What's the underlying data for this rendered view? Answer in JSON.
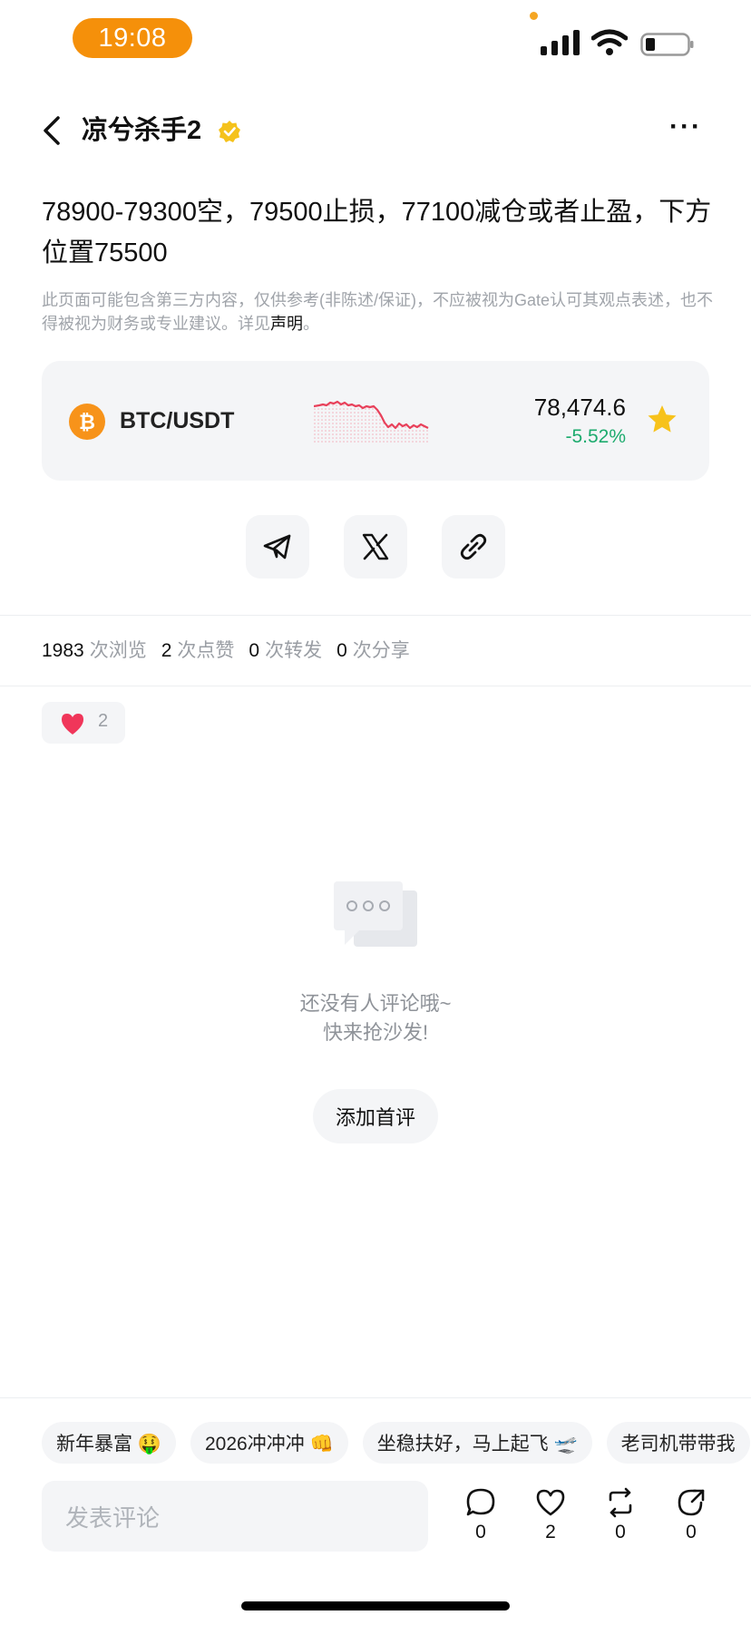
{
  "status_bar": {
    "time": "19:08",
    "signal_icon": "cellular-signal-icon",
    "wifi_icon": "wifi-icon",
    "battery_icon": "battery-low-icon"
  },
  "header": {
    "title": "凉兮杀手2",
    "verified_icon": "verified-badge-icon",
    "more": "···"
  },
  "post": {
    "text": "78900-79300空，79500止损，77100减仓或者止盈，下方位置75500",
    "disclaimer_prefix": "此页面可能包含第三方内容，仅供参考(非陈述/保证)，不应被视为Gate认可其观点表述，也不得被视为财务或专业建议。详见",
    "disclaimer_link": "声明",
    "disclaimer_suffix": "。"
  },
  "ticker": {
    "pair": "BTC/USDT",
    "price": "78,474.6",
    "change": "-5.52%",
    "sparkline_color": "#e8405a",
    "change_color": "#1dab6e",
    "favorited": true
  },
  "share": {
    "icons": [
      "telegram-icon",
      "x-icon",
      "link-icon"
    ]
  },
  "stats": {
    "views": "1983",
    "views_label": "次浏览",
    "likes": "2",
    "likes_label": "次点赞",
    "reposts": "0",
    "reposts_label": "次转发",
    "shares": "0",
    "shares_label": "次分享"
  },
  "reactions": {
    "heart_count": "2"
  },
  "empty_comments": {
    "line1": "还没有人评论哦~",
    "line2": "快来抢沙发!",
    "button": "添加首评"
  },
  "quick_tags": [
    "新年暴富 🤑",
    "2026冲冲冲 👊",
    "坐稳扶好，马上起飞 🛫",
    "老司机带带我"
  ],
  "comment_bar": {
    "placeholder": "发表评论",
    "comment_count": "0",
    "like_count": "2",
    "repost_count": "0",
    "share_count": "0"
  }
}
